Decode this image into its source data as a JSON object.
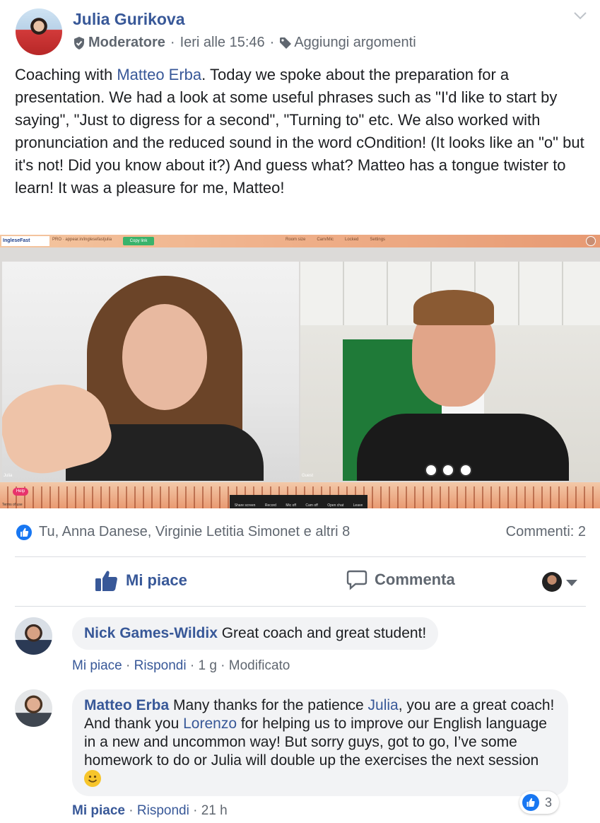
{
  "post": {
    "author": "Julia Gurikova",
    "role": "Moderatore",
    "sep1": "·",
    "timestamp": "Ieri alle 15:46",
    "sep2": "·",
    "add_topics": "Aggiungi argomenti",
    "text_1": "Coaching with ",
    "text_link": "Matteo Erba",
    "text_2": ". Today we spoke about the preparation for a presentation. We had a look at some useful phrases such as \"I'd like to start by saying\", \"Just to digress for a second\", \"Turning to\" etc. We also worked with pronunciation and the reduced sound in the word cOndition! (It looks like an \"o\" but it's not! Did you know about it?) And guess what? Matteo has a tongue twister to learn! It was a pleasure for me, Matteo!"
  },
  "photo": {
    "logo": "IngleseFast",
    "url": "PRO · appear.in/inglesefastjulia",
    "copy_link": "Copy link",
    "top_items": [
      "Room size",
      "Cam/Mic",
      "Locked",
      "Settings"
    ],
    "left_label": "Julia",
    "right_label": "Guest",
    "help": "Help",
    "terms": "Terms of use",
    "dock_items": [
      "Share screen",
      "Record",
      "Mic off",
      "Cam off",
      "Open chat",
      "Leave"
    ]
  },
  "reactions": {
    "reactors": "Tu, Anna Danese, Virginie Letitia Simonet e altri 8",
    "comments_count": "Commenti: 2"
  },
  "actions": {
    "like": "Mi piace",
    "comment": "Commenta"
  },
  "comments": [
    {
      "name": "Nick Games-Wildix",
      "text": " Great coach and great student!",
      "like": "Mi piace",
      "sep1": " · ",
      "reply": "Rispondi",
      "sep2": " · ",
      "time": "1 g",
      "sep3": " · ",
      "edited": "Modificato"
    },
    {
      "name": "Matteo Erba",
      "text_1": " Many thanks for the patience ",
      "link_1": "Julia",
      "text_2": ", you are a great coach! And thank you ",
      "link_2": "Lorenzo",
      "text_3": " for helping us to improve our English language in a new and uncommon way! But sorry guys, got to go, I’ve some homework to do or Julia will double up the exercises the next session ",
      "like": "Mi piace",
      "sep1": " · ",
      "reply": "Rispondi",
      "sep2": " · ",
      "time": "21 h",
      "reaction_count": "3"
    }
  ],
  "colors": {
    "link": "#385898",
    "meta": "#606770",
    "like_blue": "#1877f2",
    "bubble": "#f2f3f5"
  }
}
